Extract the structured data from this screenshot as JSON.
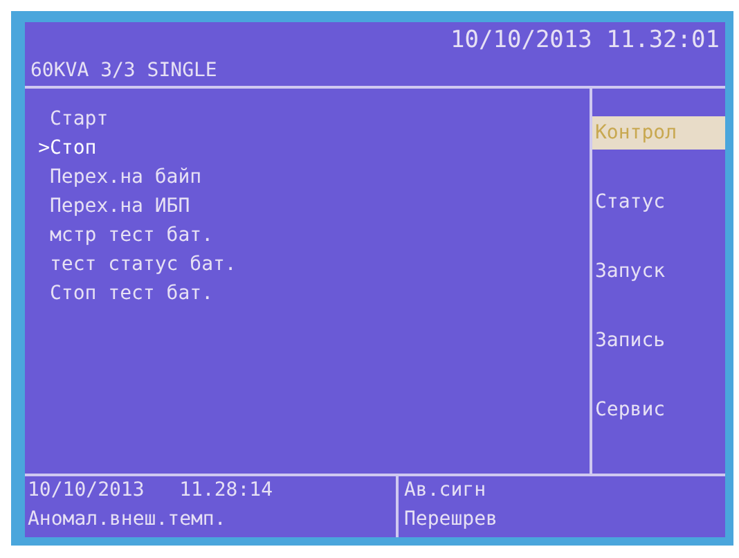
{
  "header": {
    "datetime": "10/10/2013 11.32:01",
    "model": "60KVA 3/3  SINGLE"
  },
  "cursor": ">",
  "menu": [
    {
      "label": "Старт",
      "selected": false
    },
    {
      "label": "Стоп",
      "selected": true
    },
    {
      "label": "Перех.на байп",
      "selected": false
    },
    {
      "label": "Перех.на ИБП",
      "selected": false
    },
    {
      "label": "мстр тест бат.",
      "selected": false
    },
    {
      "label": "тест статус бат.",
      "selected": false
    },
    {
      "label": "Стоп тест бат.",
      "selected": false
    }
  ],
  "side_tabs": [
    {
      "label": "Контрол",
      "selected": true
    },
    {
      "label": "Статус",
      "selected": false
    },
    {
      "label": "Запуск",
      "selected": false
    },
    {
      "label": "Запись",
      "selected": false
    },
    {
      "label": "Сервис",
      "selected": false
    }
  ],
  "status_bar": {
    "datetime": "10/10/2013   11.28:14",
    "event": "Аномал.внеш.темп.",
    "alarm_title": "Ав.сигн",
    "alarm": "Перешрев"
  }
}
